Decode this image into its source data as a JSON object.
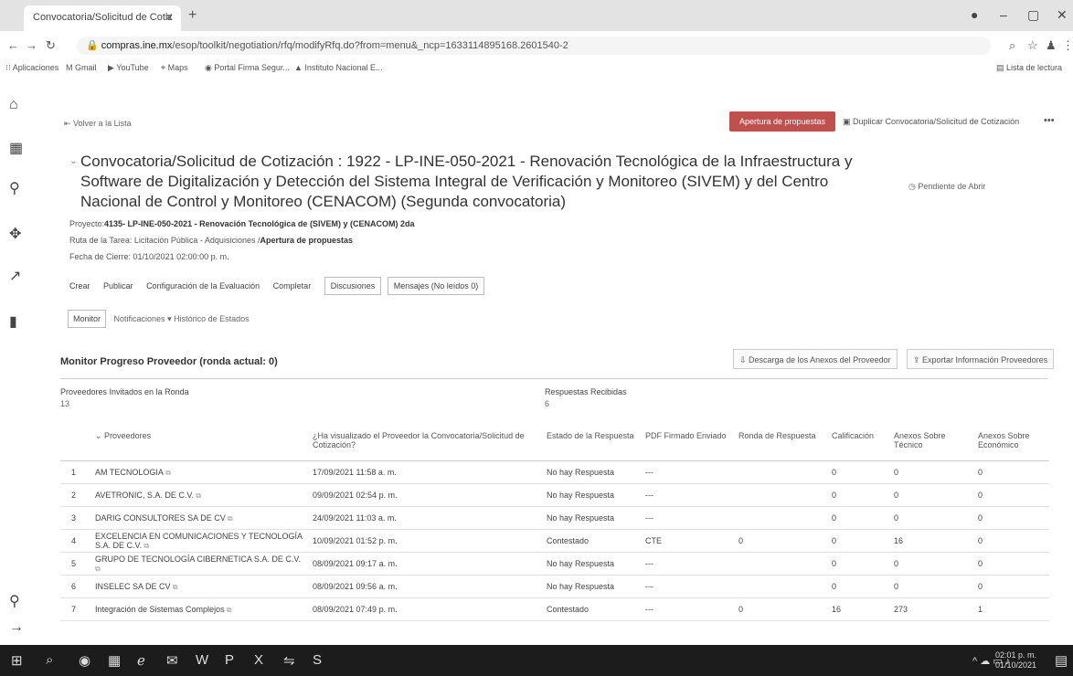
{
  "browser": {
    "tab_title": "Convocatoria/Solicitud de Cotiz",
    "url_prefix": "compras.ine.mx",
    "url_rest": "/esop/toolkit/negotiation/rfq/modifyRfq.do?from=menu&_ncp=1633114895168.2601540-2",
    "bookmarks": [
      "Aplicaciones",
      "Gmail",
      "YouTube",
      "Maps",
      "Portal Firma Segur...",
      "Instituto Nacional E..."
    ],
    "reading_list": "Lista de lectura"
  },
  "page": {
    "back_label": "Volver a la Lista",
    "apertura_button": "Apertura de propuestas",
    "duplicate_label": "Duplicar Convocatoria/Solicitud de Cotización",
    "title": "Convocatoria/Solicitud de Cotización : 1922 - LP-INE-050-2021 - Renovación Tecnológica de la Infraestructura y Software de Digitalización y Detección del Sistema Integral de Verificación y Monitoreo (SIVEM) y del Centro Nacional de Control y Monitoreo (CENACOM) (Segunda convocatoria)",
    "status": "Pendiente de Abrir",
    "project_label": "Proyecto:",
    "project_value": "4135- LP-INE-050-2021 - Renovación Tecnológica de (SIVEM) y (CENACOM) 2da",
    "route_label": "Ruta de la Tarea: Licitación Pública - Adquisiciones /",
    "route_value": "Apertura de propuestas",
    "close_date": "Fecha de Cierre: 01/10/2021 02:00:00 p. m."
  },
  "tabs": [
    "Crear",
    "Publicar",
    "Configuración de la Evaluación",
    "Completar",
    "Discusiones",
    "Mensajes (No leídos 0)"
  ],
  "subtabs": [
    "Monitor",
    "Notificaciones",
    "Histórico de Estados"
  ],
  "monitor": {
    "title": "Monitor Progreso Proveedor (ronda actual: 0)",
    "download_btn": "Descarga de los Anexos del Proveedor",
    "export_btn": "Exportar Información Proveedores",
    "invited_label": "Proveedores Invitados en la Ronda",
    "invited_value": "13",
    "responses_label": "Respuestas Recibidas",
    "responses_value": "6"
  },
  "table": {
    "headers": [
      "Proveedores",
      "¿Ha visualizado el Proveedor la Convocatoria/Solicitud de Cotización?",
      "Estado de la Respuesta",
      "PDF Firmado Enviado",
      "Ronda de Respuesta",
      "Calificación",
      "Anexos Sobre Técnico",
      "Anexos Sobre Económico"
    ],
    "rows": [
      {
        "n": "1",
        "name": "AM TECNOLOGIA",
        "viewed": "17/09/2021 11:58 a. m.",
        "estado": "No hay Respuesta",
        "pdf": "---",
        "ronda": "",
        "calif": "0",
        "tec": "0",
        "eco": "0"
      },
      {
        "n": "2",
        "name": "AVETRONIC, S.A. DE C.V.",
        "viewed": "09/09/2021 02:54 p. m.",
        "estado": "No hay Respuesta",
        "pdf": "---",
        "ronda": "",
        "calif": "0",
        "tec": "0",
        "eco": "0"
      },
      {
        "n": "3",
        "name": "DARIG CONSULTORES SA DE CV",
        "viewed": "24/09/2021 11:03 a. m.",
        "estado": "No hay Respuesta",
        "pdf": "---",
        "ronda": "",
        "calif": "0",
        "tec": "0",
        "eco": "0"
      },
      {
        "n": "4",
        "name": "EXCELENCIA EN COMUNICACIONES Y TECNOLOGÍA S.A. DE C.V.",
        "viewed": "10/09/2021 01:52 p. m.",
        "estado": "Contestado",
        "pdf": "CTE",
        "ronda": "0",
        "calif": "0",
        "tec": "16",
        "eco": "0"
      },
      {
        "n": "5",
        "name": "GRUPO DE TECNOLOGÍA CIBERNETICA S.A. DE C.V.",
        "viewed": "08/09/2021 09:17 a. m.",
        "estado": "No hay Respuesta",
        "pdf": "---",
        "ronda": "",
        "calif": "0",
        "tec": "0",
        "eco": "0"
      },
      {
        "n": "6",
        "name": "INSELEC SA DE CV",
        "viewed": "08/09/2021 09:56 a. m.",
        "estado": "No hay Respuesta",
        "pdf": "---",
        "ronda": "",
        "calif": "0",
        "tec": "0",
        "eco": "0"
      },
      {
        "n": "7",
        "name": "Integración de Sistemas Complejos",
        "viewed": "08/09/2021 07:49 p. m.",
        "estado": "Contestado",
        "pdf": "---",
        "ronda": "0",
        "calif": "16",
        "tec": "273",
        "eco": "1"
      }
    ]
  },
  "taskbar": {
    "time": "02:01 p. m.",
    "date": "01/10/2021"
  }
}
